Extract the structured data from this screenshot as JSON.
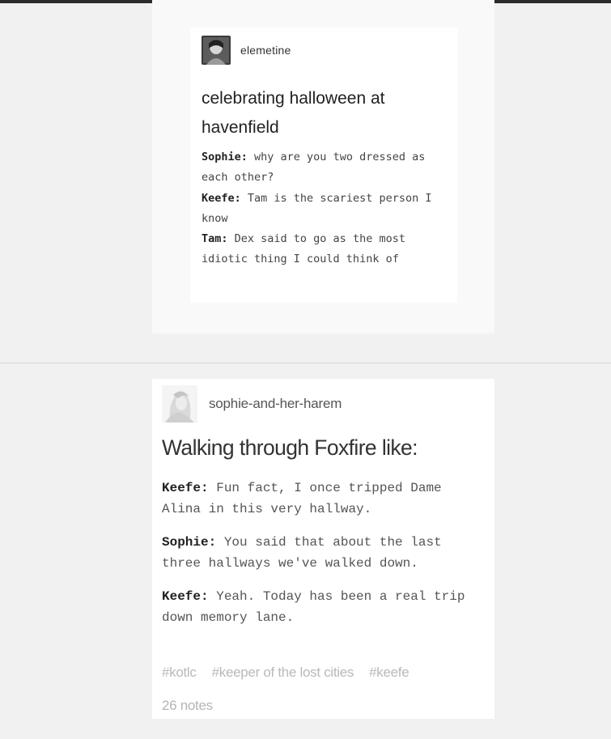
{
  "post1": {
    "username": "elemetine",
    "title": "celebrating halloween at havenfield",
    "lines": [
      {
        "speaker": "Sophie:",
        "text": " why are you two dressed as each other?"
      },
      {
        "speaker": "Keefe:",
        "text": " Tam is the scariest person I know"
      },
      {
        "speaker": "Tam:",
        "text": " Dex said to go as the most idiotic thing I could think of"
      }
    ]
  },
  "post2": {
    "username": "sophie-and-her-harem",
    "title": "Walking through Foxfire like:",
    "lines": [
      {
        "speaker": "Keefe:",
        "text": " Fun fact, I once tripped Dame Alina in this very hallway."
      },
      {
        "speaker": "Sophie:",
        "text": " You said that about the last three hallways we've walked down."
      },
      {
        "speaker": "Keefe:",
        "text": " Yeah. Today has been a real trip down memory lane."
      }
    ],
    "tags": [
      "#kotlc",
      "#keeper of the lost cities",
      "#keefe"
    ],
    "notes": "26 notes"
  }
}
